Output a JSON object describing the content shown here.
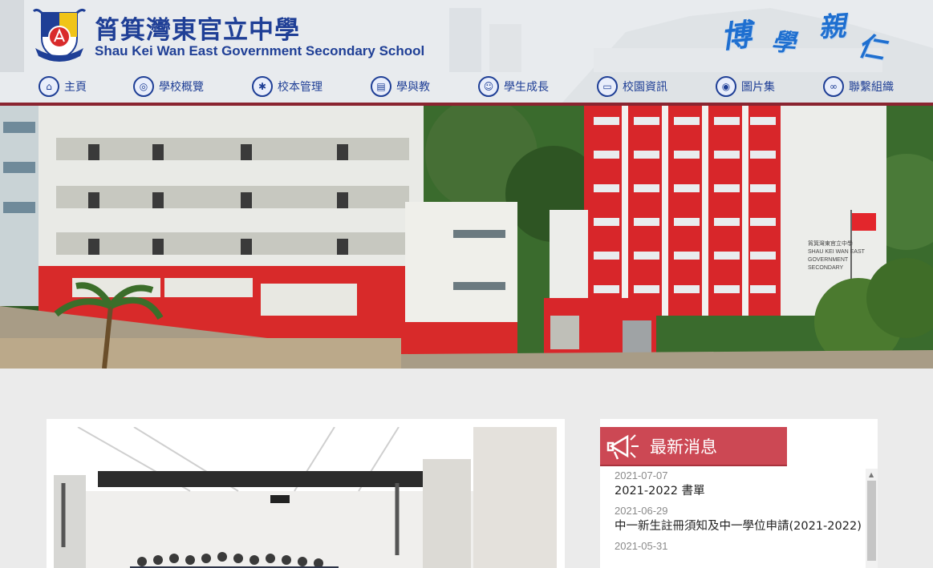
{
  "school": {
    "name_zh": "筲箕灣東官立中學",
    "name_en": "Shau Kei Wan East Government Secondary School",
    "crest_text": "博學親仁"
  },
  "motto": [
    "博",
    "學",
    "親",
    "仁"
  ],
  "nav": {
    "items": [
      {
        "label": "主頁",
        "icon": "school-icon"
      },
      {
        "label": "學校概覽",
        "icon": "globe-icon"
      },
      {
        "label": "校本管理",
        "icon": "gear-icon"
      },
      {
        "label": "學與教",
        "icon": "book-icon"
      },
      {
        "label": "學生成長",
        "icon": "student-icon"
      },
      {
        "label": "校園資訊",
        "icon": "monitor-icon"
      },
      {
        "label": "圖片集",
        "icon": "camera-icon"
      },
      {
        "label": "聯繫組織",
        "icon": "link-icon"
      }
    ]
  },
  "hero": {
    "sign_text": [
      "筲箕灣東官立中學",
      "SHAU KEI WAN EAST",
      "GOVERNMENT",
      "SECONDARY"
    ]
  },
  "news": {
    "title": "最新消息",
    "items": [
      {
        "date": "2021-07-07",
        "text": "2021-2022 書單"
      },
      {
        "date": "2021-06-29",
        "text": "中一新生註冊須知及中一學位申請(2021-2022)"
      },
      {
        "date": "2021-05-31",
        "text": ""
      }
    ]
  },
  "colors": {
    "primary_blue": "#1f3f96",
    "news_red": "#cc4854",
    "nav_divider": "#8a2430",
    "motto_blue": "#1e6fd0"
  }
}
